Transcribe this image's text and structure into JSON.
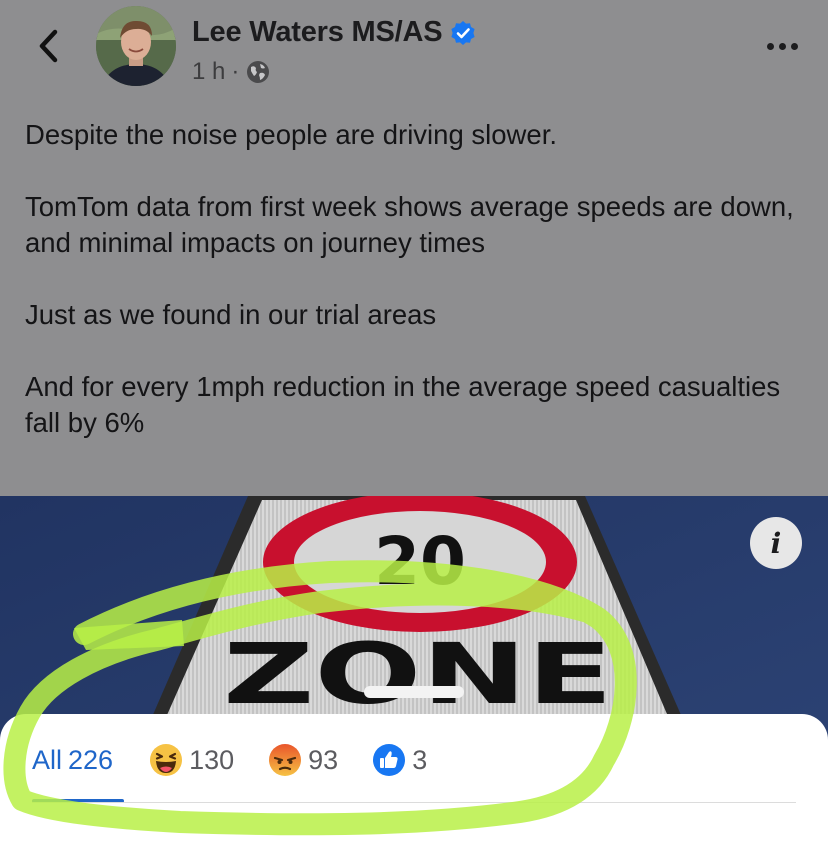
{
  "header": {
    "author_name": "Lee Waters MS/AS",
    "time_ago": "1 h",
    "separator": "·",
    "icons": {
      "back": "chevron-left-icon",
      "verified": "verified-badge-icon",
      "privacy": "globe-icon",
      "more": "more-options-icon"
    }
  },
  "post": {
    "paragraphs": [
      "Despite the noise people are driving slower.",
      "TomTom data from first week shows average speeds are down, and minimal impacts on journey times",
      "Just as we found in our trial areas",
      "And for every 1mph reduction in the average speed casualties fall by 6%"
    ]
  },
  "image": {
    "sign_number": "20",
    "sign_word": "ZONE",
    "info_label": "i"
  },
  "reactions": {
    "tabs": [
      {
        "label": "All",
        "count": "226",
        "icon": ""
      },
      {
        "label": "",
        "count": "130",
        "icon": "haha-emoji-icon"
      },
      {
        "label": "",
        "count": "93",
        "icon": "angry-emoji-icon"
      },
      {
        "label": "",
        "count": "3",
        "icon": "like-icon"
      }
    ]
  },
  "colors": {
    "accent": "#1f66c9",
    "verified": "#1877f2",
    "highlight": "#b8f046",
    "sign_red": "#c8102e"
  }
}
